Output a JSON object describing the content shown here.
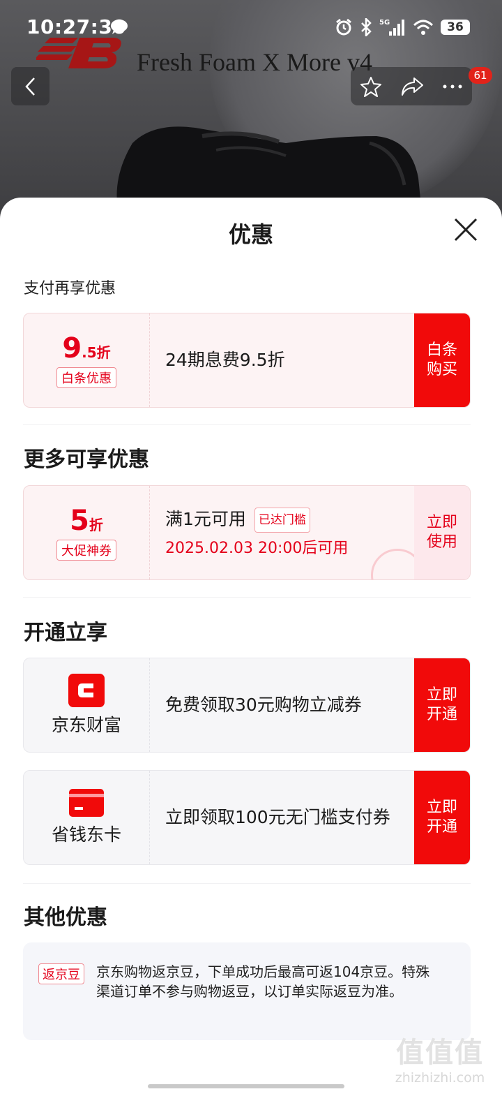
{
  "status_bar": {
    "time": "10:27:30",
    "battery": "36",
    "icons": [
      "message-bubble-icon",
      "alarm-icon",
      "bluetooth-icon",
      "5g-signal-icon",
      "wifi-icon",
      "battery-icon"
    ]
  },
  "product": {
    "title": "Fresh Foam X More v4",
    "nav_badge": "61"
  },
  "sheet": {
    "title": "优惠",
    "sections": {
      "pay": "支付再享优惠",
      "more": "更多可享优惠",
      "open": "开通立享",
      "other": "其他优惠"
    },
    "baitiao": {
      "discount_big": "9",
      "discount_small": ".5折",
      "tag": "白条优惠",
      "text": "24期息费9.5折",
      "action": "白条购买"
    },
    "coupon": {
      "discount_big": "5",
      "discount_small": "折",
      "tag": "大促神券",
      "text": "满1元可用",
      "inline_tag": "已达门槛",
      "time": "2025.02.03 20:00后可用",
      "action": "立即使用"
    },
    "jd_finance": {
      "name": "京东财富",
      "text": "免费领取30元购物立减券",
      "action": "立即开通"
    },
    "save_card": {
      "name": "省钱东卡",
      "text": "立即领取100元无门槛支付券",
      "action": "立即开通"
    },
    "jingdou": {
      "tag": "返京豆",
      "text": "京东购物返京豆，下单成功后最高可返104京豆。特殊渠道订单不参与购物返豆，以订单实际返豆为准。"
    }
  },
  "watermark": {
    "text": "值值值",
    "domain": "zhizhizhi.com"
  },
  "colors": {
    "accent": "#f10a0a",
    "discount_red": "#e4001a",
    "card_pink": "#fdf3f4",
    "card_gray": "#f6f6f8"
  }
}
